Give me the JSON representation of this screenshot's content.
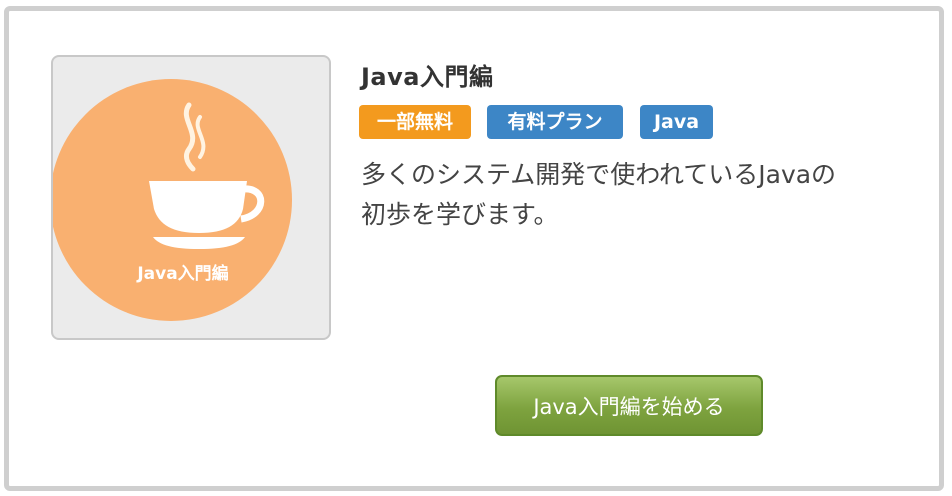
{
  "course": {
    "title": "Java入門編",
    "thumbnail_label": "Java入門編",
    "thumbnail_icon": "coffee-cup-icon",
    "tags": {
      "free": "一部無料",
      "paid": "有料プラン",
      "java": "Java"
    },
    "description_line1": "多くのシステム開発で使われているJavaの",
    "description_line2": "初歩を学びます。",
    "start_button": "Java入門編を始める"
  },
  "colors": {
    "tag_free": "#f39a1e",
    "tag_blue": "#3d86c6",
    "thumb_circle": "#f9b070",
    "button_green": "#7ea33f"
  }
}
